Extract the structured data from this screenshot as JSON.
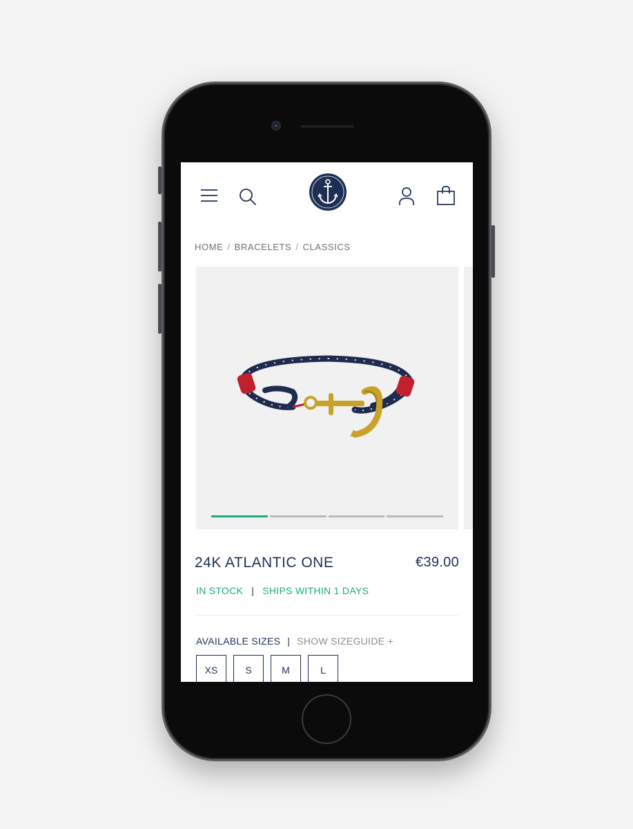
{
  "header": {
    "icons": [
      "menu-icon",
      "search-icon",
      "anchor-logo",
      "user-icon",
      "shopping-bag-icon"
    ]
  },
  "breadcrumb": [
    "HOME",
    "BRACELETS",
    "CLASSICS"
  ],
  "gallery": {
    "slide_count": 4,
    "active_slide": 1
  },
  "product": {
    "title": "24K ATLANTIC ONE",
    "price": "€39.00",
    "stock": "IN STOCK",
    "shipping": "SHIPS WITHIN 1 DAYS"
  },
  "sizes": {
    "label": "AVAILABLE SIZES",
    "guide_link": "SHOW SIZEGUIDE +",
    "options": [
      "XS",
      "S",
      "M",
      "L"
    ]
  },
  "colors": {
    "brand_navy": "#1d2f55",
    "accent_green": "#1aa985",
    "rope_red": "#c2202b",
    "anchor_gold": "#c9a227"
  }
}
